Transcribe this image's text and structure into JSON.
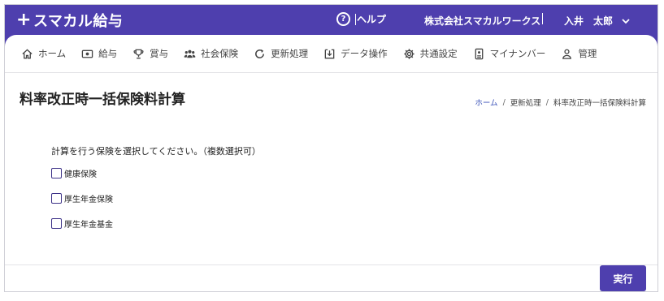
{
  "app": {
    "logo_plus": "+",
    "logo_text": "スマカル給与"
  },
  "header": {
    "help_label": "ヘルプ",
    "company": "株式会社スマカルワークス",
    "user": "入井　太郎"
  },
  "nav": [
    {
      "label": "ホーム",
      "icon": "home-icon"
    },
    {
      "label": "給与",
      "icon": "payslip-icon"
    },
    {
      "label": "賞与",
      "icon": "trophy-icon"
    },
    {
      "label": "社会保険",
      "icon": "people-icon"
    },
    {
      "label": "更新処理",
      "icon": "refresh-icon"
    },
    {
      "label": "データ操作",
      "icon": "download-icon"
    },
    {
      "label": "共通設定",
      "icon": "gear-icon"
    },
    {
      "label": "マイナンバー",
      "icon": "id-card-icon"
    },
    {
      "label": "管理",
      "icon": "user-icon"
    }
  ],
  "page": {
    "title": "料率改正時一括保険料計算",
    "breadcrumb": [
      "ホーム",
      "更新処理",
      "料率改正時一括保険料計算"
    ],
    "instruction": "計算を行う保険を選択してください。（複数選択可）",
    "options": [
      {
        "label": "健康保険",
        "checked": false
      },
      {
        "label": "厚生年金保険",
        "checked": false
      },
      {
        "label": "厚生年金基金",
        "checked": false
      }
    ],
    "run_label": "実行"
  },
  "colors": {
    "brand": "#4e3fae",
    "link": "#3b52b8"
  }
}
